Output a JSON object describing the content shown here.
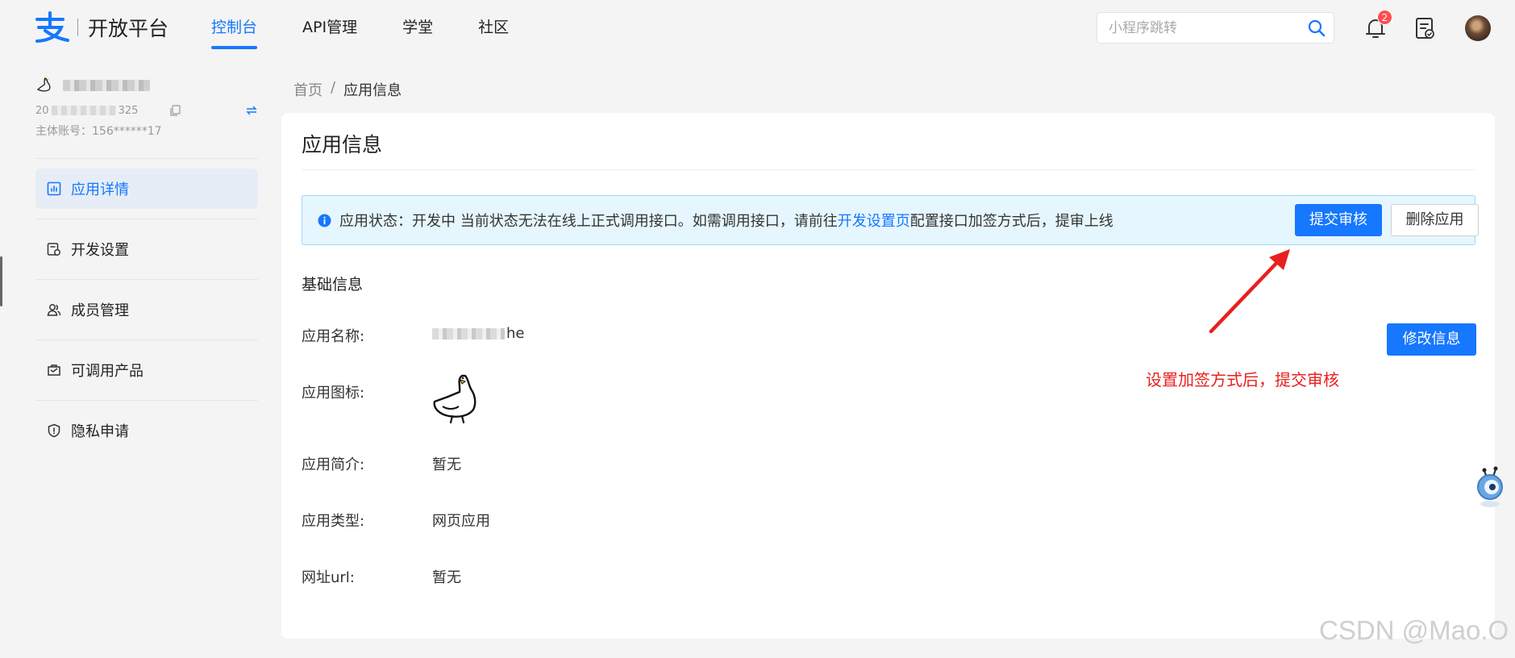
{
  "logo": {
    "text": "开放平台"
  },
  "nav": {
    "items": [
      {
        "label": "控制台",
        "active": true
      },
      {
        "label": "API管理",
        "active": false
      },
      {
        "label": "学堂",
        "active": false
      },
      {
        "label": "社区",
        "active": false
      }
    ]
  },
  "search": {
    "placeholder": "小程序跳转"
  },
  "notifications": {
    "count": "2"
  },
  "sidebar": {
    "id_prefix": "20",
    "id_suffix": "325",
    "account_label": "主体账号：",
    "account_value": "156******17",
    "items": [
      {
        "label": "应用详情",
        "icon": "chart-icon",
        "active": true
      },
      {
        "label": "开发设置",
        "icon": "settings-doc-icon",
        "active": false
      },
      {
        "label": "成员管理",
        "icon": "members-icon",
        "active": false
      },
      {
        "label": "可调用产品",
        "icon": "products-icon",
        "active": false
      },
      {
        "label": "隐私申请",
        "icon": "shield-icon",
        "active": false
      }
    ]
  },
  "breadcrumb": {
    "home": "首页",
    "separator": "/",
    "current": "应用信息"
  },
  "card": {
    "title": "应用信息",
    "alert": {
      "prefix": "应用状态：开发中 当前状态无法在线上正式调用接口。如需调用接口，请前往",
      "link": "开发设置页",
      "suffix": "配置接口加签方式后，提审上线"
    },
    "submit_label": "提交审核",
    "delete_label": "删除应用",
    "section_title": "基础信息",
    "edit_label": "修改信息",
    "fields": {
      "name_label": "应用名称:",
      "name_value_suffix": "he",
      "icon_label": "应用图标:",
      "intro_label": "应用简介:",
      "intro_value": "暂无",
      "type_label": "应用类型:",
      "type_value": "网页应用",
      "url_label": "网址url:",
      "url_value": "暂无"
    }
  },
  "annotation": {
    "text": "设置加签方式后，提交审核",
    "color": "#e8201f"
  },
  "watermark": {
    "text": "CSDN @Mao.O"
  },
  "colors": {
    "primary": "#1677ff",
    "alert_bg": "#e6f6fe",
    "alert_border": "#9dd8f8"
  }
}
